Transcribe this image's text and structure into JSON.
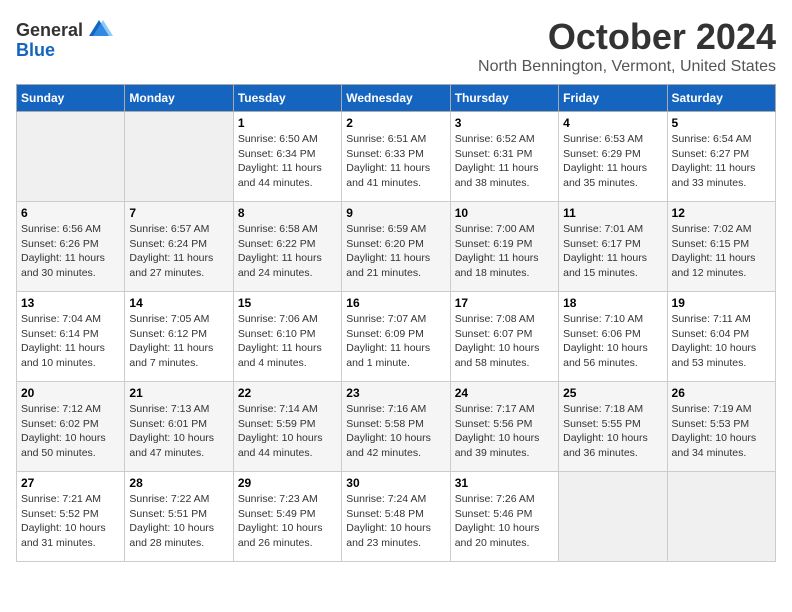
{
  "logo": {
    "general": "General",
    "blue": "Blue"
  },
  "title": "October 2024",
  "location": "North Bennington, Vermont, United States",
  "headers": [
    "Sunday",
    "Monday",
    "Tuesday",
    "Wednesday",
    "Thursday",
    "Friday",
    "Saturday"
  ],
  "weeks": [
    [
      {
        "day": "",
        "detail": ""
      },
      {
        "day": "",
        "detail": ""
      },
      {
        "day": "1",
        "detail": "Sunrise: 6:50 AM\nSunset: 6:34 PM\nDaylight: 11 hours and 44 minutes."
      },
      {
        "day": "2",
        "detail": "Sunrise: 6:51 AM\nSunset: 6:33 PM\nDaylight: 11 hours and 41 minutes."
      },
      {
        "day": "3",
        "detail": "Sunrise: 6:52 AM\nSunset: 6:31 PM\nDaylight: 11 hours and 38 minutes."
      },
      {
        "day": "4",
        "detail": "Sunrise: 6:53 AM\nSunset: 6:29 PM\nDaylight: 11 hours and 35 minutes."
      },
      {
        "day": "5",
        "detail": "Sunrise: 6:54 AM\nSunset: 6:27 PM\nDaylight: 11 hours and 33 minutes."
      }
    ],
    [
      {
        "day": "6",
        "detail": "Sunrise: 6:56 AM\nSunset: 6:26 PM\nDaylight: 11 hours and 30 minutes."
      },
      {
        "day": "7",
        "detail": "Sunrise: 6:57 AM\nSunset: 6:24 PM\nDaylight: 11 hours and 27 minutes."
      },
      {
        "day": "8",
        "detail": "Sunrise: 6:58 AM\nSunset: 6:22 PM\nDaylight: 11 hours and 24 minutes."
      },
      {
        "day": "9",
        "detail": "Sunrise: 6:59 AM\nSunset: 6:20 PM\nDaylight: 11 hours and 21 minutes."
      },
      {
        "day": "10",
        "detail": "Sunrise: 7:00 AM\nSunset: 6:19 PM\nDaylight: 11 hours and 18 minutes."
      },
      {
        "day": "11",
        "detail": "Sunrise: 7:01 AM\nSunset: 6:17 PM\nDaylight: 11 hours and 15 minutes."
      },
      {
        "day": "12",
        "detail": "Sunrise: 7:02 AM\nSunset: 6:15 PM\nDaylight: 11 hours and 12 minutes."
      }
    ],
    [
      {
        "day": "13",
        "detail": "Sunrise: 7:04 AM\nSunset: 6:14 PM\nDaylight: 11 hours and 10 minutes."
      },
      {
        "day": "14",
        "detail": "Sunrise: 7:05 AM\nSunset: 6:12 PM\nDaylight: 11 hours and 7 minutes."
      },
      {
        "day": "15",
        "detail": "Sunrise: 7:06 AM\nSunset: 6:10 PM\nDaylight: 11 hours and 4 minutes."
      },
      {
        "day": "16",
        "detail": "Sunrise: 7:07 AM\nSunset: 6:09 PM\nDaylight: 11 hours and 1 minute."
      },
      {
        "day": "17",
        "detail": "Sunrise: 7:08 AM\nSunset: 6:07 PM\nDaylight: 10 hours and 58 minutes."
      },
      {
        "day": "18",
        "detail": "Sunrise: 7:10 AM\nSunset: 6:06 PM\nDaylight: 10 hours and 56 minutes."
      },
      {
        "day": "19",
        "detail": "Sunrise: 7:11 AM\nSunset: 6:04 PM\nDaylight: 10 hours and 53 minutes."
      }
    ],
    [
      {
        "day": "20",
        "detail": "Sunrise: 7:12 AM\nSunset: 6:02 PM\nDaylight: 10 hours and 50 minutes."
      },
      {
        "day": "21",
        "detail": "Sunrise: 7:13 AM\nSunset: 6:01 PM\nDaylight: 10 hours and 47 minutes."
      },
      {
        "day": "22",
        "detail": "Sunrise: 7:14 AM\nSunset: 5:59 PM\nDaylight: 10 hours and 44 minutes."
      },
      {
        "day": "23",
        "detail": "Sunrise: 7:16 AM\nSunset: 5:58 PM\nDaylight: 10 hours and 42 minutes."
      },
      {
        "day": "24",
        "detail": "Sunrise: 7:17 AM\nSunset: 5:56 PM\nDaylight: 10 hours and 39 minutes."
      },
      {
        "day": "25",
        "detail": "Sunrise: 7:18 AM\nSunset: 5:55 PM\nDaylight: 10 hours and 36 minutes."
      },
      {
        "day": "26",
        "detail": "Sunrise: 7:19 AM\nSunset: 5:53 PM\nDaylight: 10 hours and 34 minutes."
      }
    ],
    [
      {
        "day": "27",
        "detail": "Sunrise: 7:21 AM\nSunset: 5:52 PM\nDaylight: 10 hours and 31 minutes."
      },
      {
        "day": "28",
        "detail": "Sunrise: 7:22 AM\nSunset: 5:51 PM\nDaylight: 10 hours and 28 minutes."
      },
      {
        "day": "29",
        "detail": "Sunrise: 7:23 AM\nSunset: 5:49 PM\nDaylight: 10 hours and 26 minutes."
      },
      {
        "day": "30",
        "detail": "Sunrise: 7:24 AM\nSunset: 5:48 PM\nDaylight: 10 hours and 23 minutes."
      },
      {
        "day": "31",
        "detail": "Sunrise: 7:26 AM\nSunset: 5:46 PM\nDaylight: 10 hours and 20 minutes."
      },
      {
        "day": "",
        "detail": ""
      },
      {
        "day": "",
        "detail": ""
      }
    ]
  ]
}
